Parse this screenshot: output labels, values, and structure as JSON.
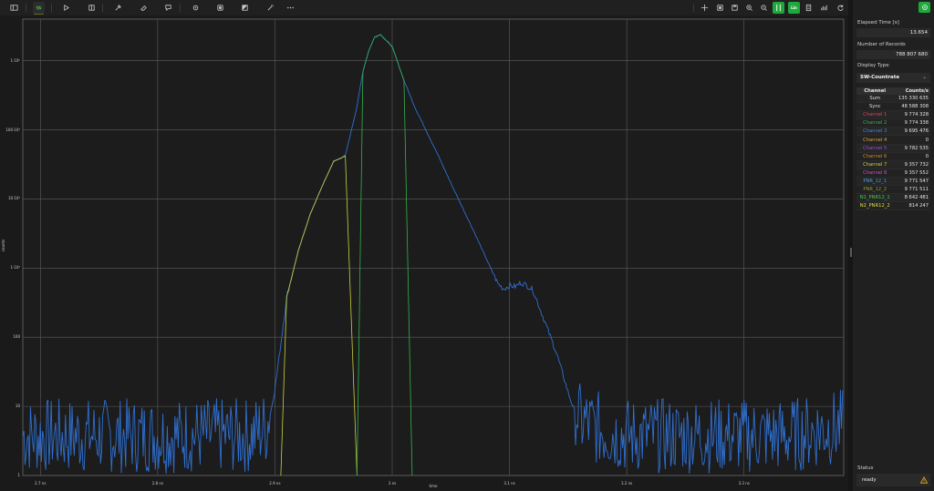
{
  "toolbar": {
    "left_icons": [
      "sidebar-toggle-icon",
      "link-icon",
      "play-icon",
      "split-icon",
      "pipette-icon",
      "eraser-icon",
      "comment-icon",
      "settings-icon",
      "dual-panel-icon",
      "contrast-icon",
      "magic-wand-icon",
      "more-icon"
    ],
    "right_icons": [
      "move-icon",
      "fit-icon",
      "save-icon",
      "zoom-in-icon",
      "zoom-out-icon",
      "cursor-lines-icon",
      "log-scale-icon",
      "document-icon",
      "bar-chart-icon",
      "reset-icon"
    ],
    "log_scale_label": "Lin"
  },
  "chart_data": {
    "type": "line",
    "xlabel": "time",
    "ylabel": "counts",
    "x_unit": "ns",
    "x_ticks": [
      "2.7 ns",
      "2.8 ns",
      "2.9 ns",
      "3 ns",
      "3.1 ns",
      "3.2 ns",
      "3.3 ns"
    ],
    "y_ticks": [
      "1",
      "10",
      "100",
      "1·10³",
      "10·10³",
      "100·10³",
      "1·10⁶"
    ],
    "y_scale": "log",
    "xlim": [
      2.685,
      3.385
    ],
    "ylim": [
      1,
      4000000
    ],
    "grid": true,
    "series": [
      {
        "color": "#2f6fd0",
        "x": [
          2.685,
          2.7,
          2.72,
          2.74,
          2.76,
          2.78,
          2.8,
          2.82,
          2.84,
          2.86,
          2.88,
          2.893,
          2.9,
          2.905,
          2.91,
          2.92,
          2.93,
          2.94,
          2.95,
          2.96,
          2.97,
          2.975,
          2.98,
          2.985,
          2.99,
          3.0,
          3.01,
          3.02,
          3.03,
          3.04,
          3.05,
          3.06,
          3.07,
          3.08,
          3.09,
          3.095,
          3.1,
          3.105,
          3.11,
          3.115,
          3.12,
          3.13,
          3.14,
          3.15,
          3.16,
          3.18,
          3.2,
          3.22,
          3.24,
          3.26,
          3.28,
          3.3,
          3.32,
          3.34,
          3.36,
          3.38
        ],
        "y": [
          3,
          3,
          3,
          3,
          3,
          3,
          3,
          3,
          3,
          3,
          3,
          4,
          18,
          80,
          380,
          1800,
          6000,
          15000,
          35000,
          42000,
          220000,
          700000,
          1400000,
          2200000,
          2400000,
          1600000,
          520000,
          200000,
          90000,
          40000,
          17000,
          7500,
          3300,
          1400,
          600,
          500,
          560,
          540,
          620,
          560,
          480,
          170,
          60,
          16,
          5,
          3.5,
          3,
          3,
          3,
          3,
          3,
          3,
          3,
          3,
          3.5,
          4
        ]
      },
      {
        "color": "#c8d23a",
        "x": [
          2.905,
          2.91,
          2.92,
          2.93,
          2.94,
          2.95,
          2.96,
          2.97
        ],
        "y": [
          1,
          380,
          1800,
          6000,
          15000,
          35000,
          42000,
          1
        ]
      },
      {
        "color": "#34b34a",
        "x": [
          2.97,
          2.975,
          2.98,
          2.985,
          2.99,
          3.0,
          3.01,
          3.017
        ],
        "y": [
          1,
          700000,
          1400000,
          2200000,
          2400000,
          1600000,
          520000,
          1
        ]
      }
    ]
  },
  "panel": {
    "elapsed_label": "Elapsed Time [s]",
    "elapsed_value": "13.654",
    "records_label": "Number of Records",
    "records_value": "788 807 680",
    "display_type_label": "Display Type",
    "display_type_value": "SW-Countrate",
    "table_headers": [
      "Channel",
      "Counts/s"
    ],
    "table_rows": [
      {
        "name": "Sum",
        "value": "135 330 635",
        "color": "#e0e0e0"
      },
      {
        "name": "Sync",
        "value": "48 588 308",
        "color": "#e0e0e0"
      },
      {
        "name": "Channel 1",
        "value": "9 774 328",
        "color": "#e0425a"
      },
      {
        "name": "Channel 2",
        "value": "9 774 338",
        "color": "#3fae5c"
      },
      {
        "name": "Channel 3",
        "value": "9 695 476",
        "color": "#4d7fe0"
      },
      {
        "name": "Channel 4",
        "value": "0",
        "color": "#d8a63a"
      },
      {
        "name": "Channel 5",
        "value": "9 782 535",
        "color": "#9b4fd6"
      },
      {
        "name": "Channel 6",
        "value": "0",
        "color": "#d08a2a"
      },
      {
        "name": "Channel 7",
        "value": "9 357 732",
        "color": "#c8d23a"
      },
      {
        "name": "Channel 8",
        "value": "9 357 552",
        "color": "#d84ac0"
      },
      {
        "name": "PNR_12_1",
        "value": "9 771 547",
        "color": "#3a9ee0"
      },
      {
        "name": "PNR_12_2",
        "value": "9 771 511",
        "color": "#8a9a3a"
      },
      {
        "name": "N1_PNR12_1",
        "value": "8 642 481",
        "color": "#3cd04a"
      },
      {
        "name": "N2_PNR12_2",
        "value": "814 247",
        "color": "#e0e040"
      }
    ],
    "status_label": "Status",
    "status_value": "ready"
  }
}
